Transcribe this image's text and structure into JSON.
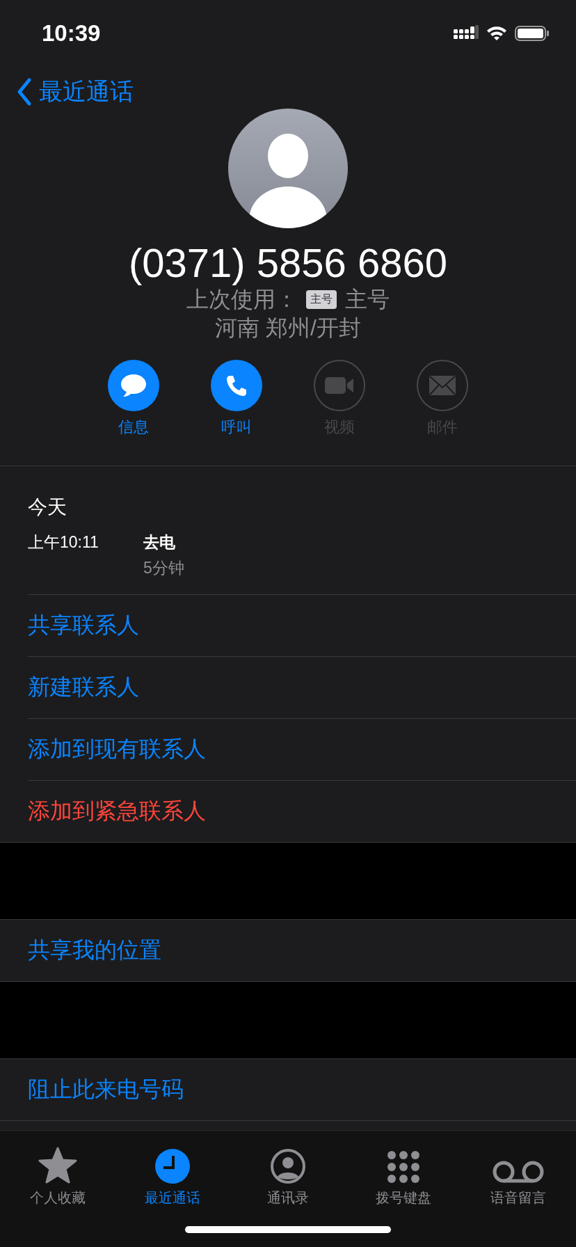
{
  "status_bar": {
    "time": "10:39"
  },
  "nav": {
    "back_label": "最近通话"
  },
  "contact": {
    "number": "(0371) 5856 6860",
    "last_used_label": "上次使用：",
    "last_used_badge": "主号",
    "last_used_value": "主号",
    "location": "河南 郑州/开封"
  },
  "actions": [
    {
      "kind": "message",
      "label": "信息",
      "disabled": false
    },
    {
      "kind": "call",
      "label": "呼叫",
      "disabled": false
    },
    {
      "kind": "video",
      "label": "视频",
      "disabled": true
    },
    {
      "kind": "mail",
      "label": "邮件",
      "disabled": true
    }
  ],
  "history": {
    "date": "今天",
    "calls": [
      {
        "time": "上午10:11",
        "type": "去电",
        "duration": "5分钟"
      }
    ]
  },
  "sections": [
    {
      "items": [
        {
          "label": "共享联系人",
          "destructive": false
        },
        {
          "label": "新建联系人",
          "destructive": false
        },
        {
          "label": "添加到现有联系人",
          "destructive": false
        },
        {
          "label": "添加到紧急联系人",
          "destructive": true
        }
      ]
    },
    {
      "items": [
        {
          "label": "共享我的位置",
          "destructive": false
        }
      ]
    },
    {
      "items": [
        {
          "label": "阻止此来电号码",
          "destructive": false
        }
      ]
    }
  ],
  "tab_bar": [
    {
      "kind": "favorites",
      "label": "个人收藏",
      "selected": false
    },
    {
      "kind": "recents",
      "label": "最近通话",
      "selected": true
    },
    {
      "kind": "contacts",
      "label": "通讯录",
      "selected": false
    },
    {
      "kind": "keypad",
      "label": "拨号键盘",
      "selected": false
    },
    {
      "kind": "voicemail",
      "label": "语音留言",
      "selected": false
    }
  ]
}
